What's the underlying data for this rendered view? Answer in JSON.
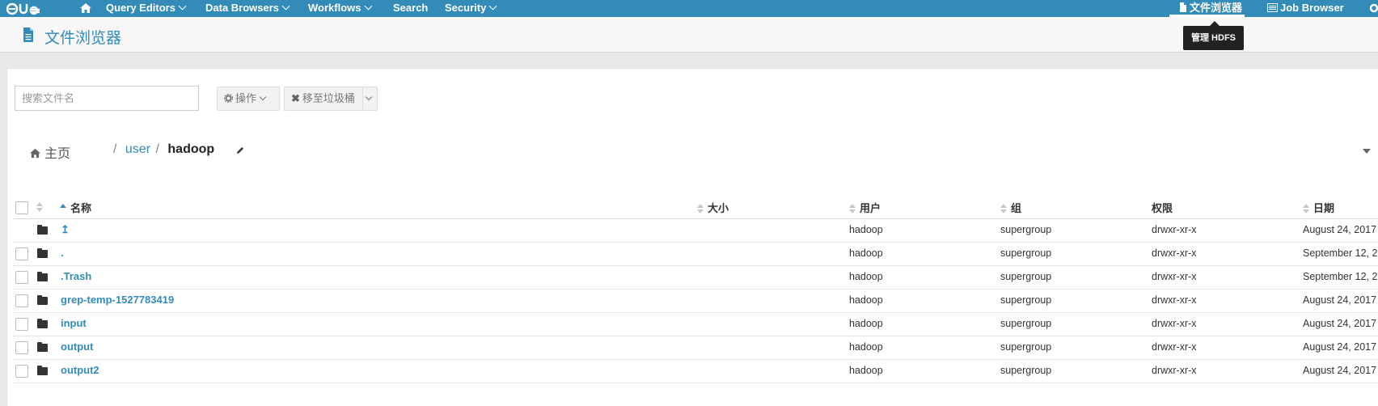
{
  "navbar": {
    "logo": "HUE",
    "items": [
      {
        "label": "Query Editors",
        "caret": true
      },
      {
        "label": "Data Browsers",
        "caret": true
      },
      {
        "label": "Workflows",
        "caret": true
      },
      {
        "label": "Search",
        "caret": false
      },
      {
        "label": "Security",
        "caret": true
      }
    ],
    "right_items": [
      {
        "label": "文件浏览器",
        "icon": "file-icon",
        "active": true
      },
      {
        "label": "Job Browser",
        "icon": "list-icon",
        "active": false
      }
    ]
  },
  "header": {
    "title": "文件浏览器",
    "icon": "file-icon"
  },
  "tooltip": {
    "text": "管理 HDFS"
  },
  "toolbar": {
    "search_placeholder": "搜索文件名",
    "actions_label": "操作",
    "trash_label": "移至垃圾桶"
  },
  "breadcrumb": {
    "home_label": "主页",
    "segments": [
      "user",
      "hadoop"
    ]
  },
  "table": {
    "columns": [
      "名称",
      "大小",
      "用户",
      "组",
      "权限",
      "日期"
    ],
    "rows": [
      {
        "name": "↥",
        "user": "hadoop",
        "group": "supergroup",
        "perm": "drwxr-xr-x",
        "date": "August 24, 2017",
        "checkbox": false
      },
      {
        "name": ".",
        "user": "hadoop",
        "group": "supergroup",
        "perm": "drwxr-xr-x",
        "date": "September 12, 2",
        "checkbox": true
      },
      {
        "name": ".Trash",
        "user": "hadoop",
        "group": "supergroup",
        "perm": "drwxr-xr-x",
        "date": "September 12, 2",
        "checkbox": true
      },
      {
        "name": "grep-temp-1527783419",
        "user": "hadoop",
        "group": "supergroup",
        "perm": "drwxr-xr-x",
        "date": "August 24, 2017",
        "checkbox": true
      },
      {
        "name": "input",
        "user": "hadoop",
        "group": "supergroup",
        "perm": "drwxr-xr-x",
        "date": "August 24, 2017",
        "checkbox": true
      },
      {
        "name": "output",
        "user": "hadoop",
        "group": "supergroup",
        "perm": "drwxr-xr-x",
        "date": "August 24, 2017",
        "checkbox": true
      },
      {
        "name": "output2",
        "user": "hadoop",
        "group": "supergroup",
        "perm": "drwxr-xr-x",
        "date": "August 24, 2017",
        "checkbox": true
      }
    ]
  },
  "colors": {
    "navbar": "#338bb8",
    "link": "#338bb8",
    "tooltip_bg": "#222222"
  }
}
